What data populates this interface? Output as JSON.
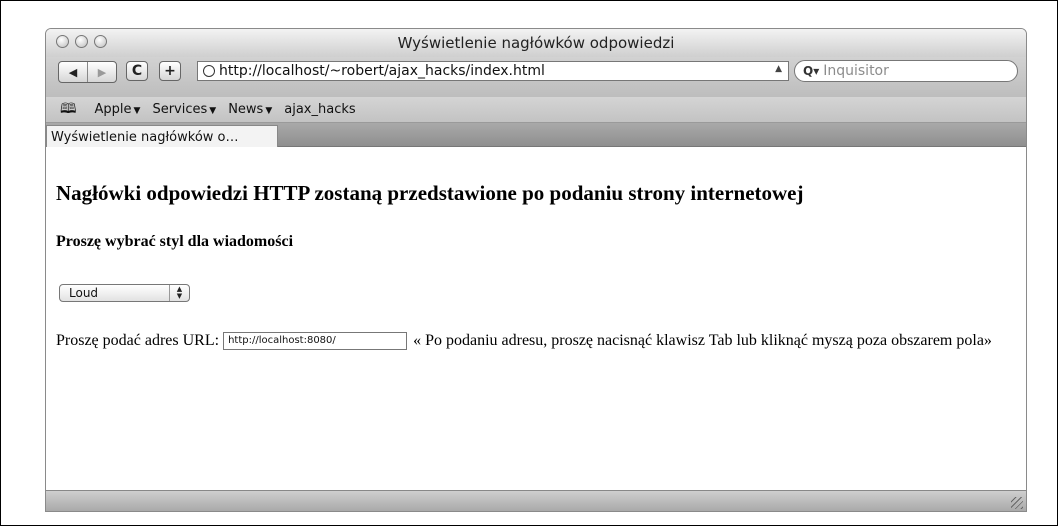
{
  "window": {
    "title": "Wyświetlenie nagłówków odpowiedzi"
  },
  "toolbar": {
    "back_icon": "◀",
    "forward_icon": "▶",
    "reload_icon": "C",
    "add_icon": "+",
    "address": "http://localhost/~robert/ajax_hacks/index.html",
    "search_placeholder": "Inquisitor"
  },
  "bookmarks": {
    "items": [
      {
        "label": "Apple",
        "has_menu": true
      },
      {
        "label": "Services",
        "has_menu": true
      },
      {
        "label": "News",
        "has_menu": true
      },
      {
        "label": "ajax_hacks",
        "has_menu": false
      }
    ]
  },
  "tabs": [
    {
      "label": "Wyświetlenie nagłówków o…",
      "active": true
    }
  ],
  "page": {
    "heading": "Nagłówki odpowiedzi HTTP zostaną przedstawione po podaniu strony internetowej",
    "subheading": "Proszę wybrać styl dla wiadomości",
    "style_select": {
      "selected": "Loud"
    },
    "url_label": "Proszę podać adres URL:",
    "url_value": "http://localhost:8080/",
    "url_hint": "« Po podaniu adresu, proszę nacisnąć klawisz Tab lub kliknąć myszą poza obszarem pola»"
  },
  "icons": {
    "bookmarks": "open-book-icon",
    "address": "globe-icon",
    "search": "magnifier-icon",
    "resize": "resize-grip-icon"
  }
}
